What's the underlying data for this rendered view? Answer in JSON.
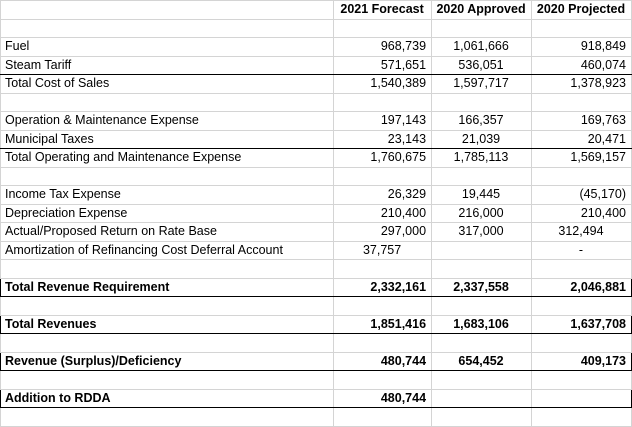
{
  "headers": [
    "2021 Forecast",
    "2020 Approved",
    "2020 Projected"
  ],
  "cost_of_sales": {
    "fuel": {
      "label": "Fuel",
      "v": [
        "968,739",
        "1,061,666",
        "918,849"
      ]
    },
    "steam": {
      "label": "Steam Tariff",
      "v": [
        "571,651",
        "536,051",
        "460,074"
      ]
    },
    "total": {
      "label": "Total Cost of Sales",
      "v": [
        "1,540,389",
        "1,597,717",
        "1,378,923"
      ]
    }
  },
  "opex": {
    "om": {
      "label": "Operation & Maintenance Expense",
      "v": [
        "197,143",
        "166,357",
        "169,763"
      ]
    },
    "muni": {
      "label": "Municipal Taxes",
      "v": [
        "23,143",
        "21,039",
        "20,471"
      ]
    },
    "total": {
      "label": "Total Operating and Maintenance Expense",
      "v": [
        "1,760,675",
        "1,785,113",
        "1,569,157"
      ]
    }
  },
  "other": {
    "tax": {
      "label": "Income Tax Expense",
      "v": [
        "26,329",
        "19,445",
        "(45,170)"
      ]
    },
    "dep": {
      "label": "Depreciation Expense",
      "v": [
        "210,400",
        "216,000",
        "210,400"
      ]
    },
    "ret": {
      "label": "Actual/Proposed Return on Rate Base",
      "v": [
        "297,000",
        "317,000",
        "312,494"
      ]
    },
    "amort": {
      "label": "Amortization of Refinancing Cost Deferral Account",
      "v": [
        "37,757",
        "",
        "-"
      ]
    }
  },
  "totals": {
    "rev_req": {
      "label": "Total Revenue Requirement",
      "v": [
        "2,332,161",
        "2,337,558",
        "2,046,881"
      ]
    },
    "revenues": {
      "label": "Total Revenues",
      "v": [
        "1,851,416",
        "1,683,106",
        "1,637,708"
      ]
    },
    "surplus": {
      "label": "Revenue (Surplus)/Deficiency",
      "v": [
        "480,744",
        "654,452",
        "409,173"
      ]
    },
    "rdda": {
      "label": "Addition to RDDA",
      "v": [
        "480,744",
        "",
        ""
      ]
    }
  }
}
